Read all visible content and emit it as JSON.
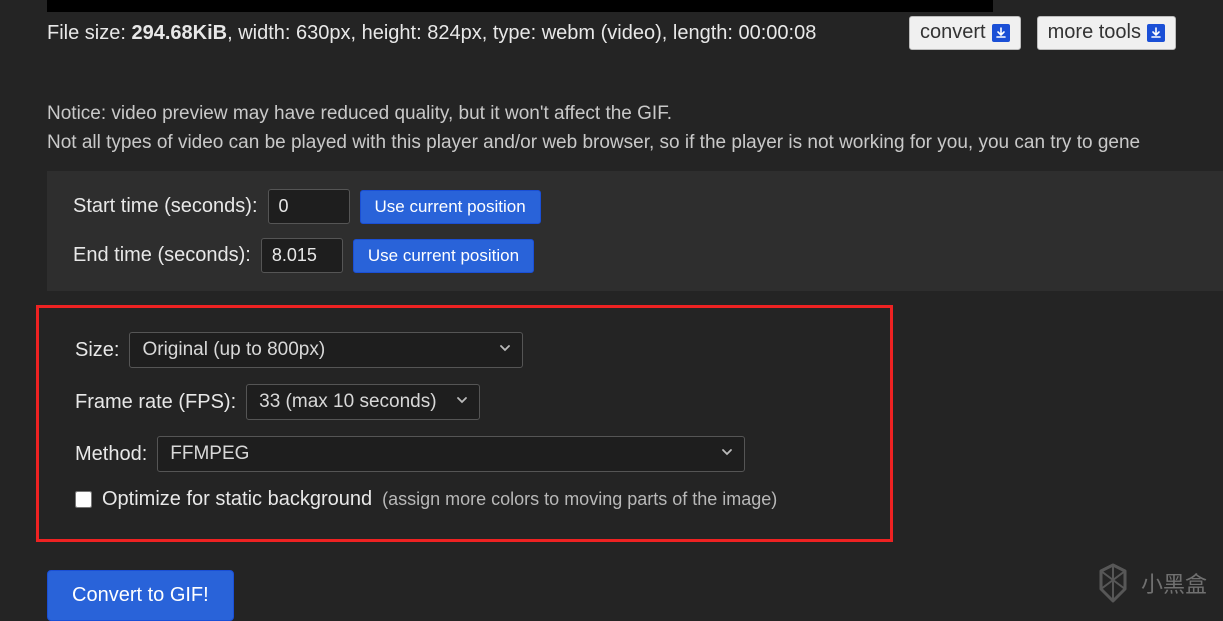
{
  "file_info": {
    "prefix": "File size: ",
    "size": "294.68KiB",
    "rest": ", width: 630px, height: 824px, type: webm (video), length: 00:00:08"
  },
  "actions": {
    "convert": "convert",
    "more_tools": "more tools"
  },
  "notice": {
    "l1": "Notice: video preview may have reduced quality, but it won't affect the GIF.",
    "l2": "Not all types of video can be played with this player and/or web browser, so if the player is not working for you, you can try to gene"
  },
  "time": {
    "start_label": "Start time (seconds):",
    "start_value": "0",
    "end_label": "End time (seconds):",
    "end_value": "8.015",
    "use_current": "Use current position"
  },
  "size": {
    "label": "Size:",
    "selected": "Original (up to 800px)"
  },
  "fps": {
    "label": "Frame rate (FPS):",
    "selected": "33 (max 10 seconds)"
  },
  "method": {
    "label": "Method:",
    "selected": "FFMPEG"
  },
  "optimize": {
    "label": "Optimize for static background",
    "hint": "(assign more colors to moving parts of the image)",
    "checked": false
  },
  "convert_btn": "Convert to GIF!",
  "watermark": "小黑盒"
}
